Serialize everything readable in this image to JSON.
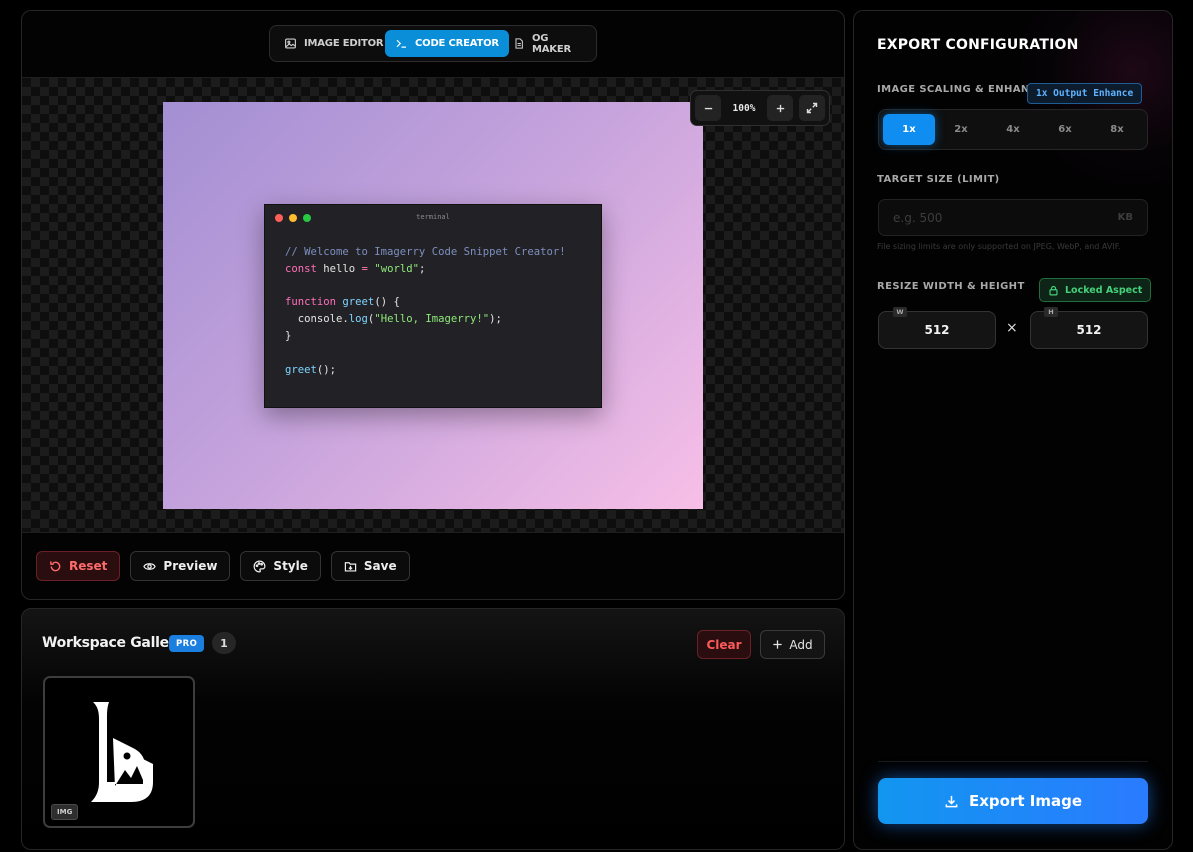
{
  "mode_tabs": [
    {
      "label": "IMAGE EDITOR",
      "icon": "image-icon",
      "active": false
    },
    {
      "label": "CODE CREATOR",
      "icon": "terminal-icon",
      "active": true
    },
    {
      "label": "OG MAKER",
      "icon": "document-icon",
      "active": false
    }
  ],
  "canvas": {
    "zoom_label": "100%",
    "terminal_title": "terminal",
    "code_lines": [
      "// Welcome to Imagerry Code Snippet Creator!",
      "const hello = \"world\";",
      "",
      "function greet() {",
      "  console.log(\"Hello, Imagerry!\");",
      "}",
      "",
      "greet();"
    ]
  },
  "actions": {
    "reset": "Reset",
    "preview": "Preview",
    "style": "Style",
    "save": "Save"
  },
  "gallery": {
    "title": "Workspace Gallery",
    "pro_badge": "PRO",
    "count": "1",
    "clear_label": "Clear",
    "add_label": "Add",
    "items": [
      {
        "tag": "IMG"
      }
    ]
  },
  "export": {
    "title": "EXPORT CONFIGURATION",
    "scaling_label": "IMAGE SCALING & ENHANCE",
    "enhance_badge": "1x Output Enhance",
    "scale_options": [
      "1x",
      "2x",
      "4x",
      "6x",
      "8x"
    ],
    "selected_scale": "1x",
    "target_label": "TARGET SIZE (LIMIT)",
    "target_placeholder": "e.g. 500",
    "target_unit": "KB",
    "target_hint": "File sizing limits are only supported on JPEG, WebP, and AVIF.",
    "resize_label": "RESIZE WIDTH & HEIGHT",
    "lock_label": "Locked Aspect",
    "width_tag": "W",
    "height_tag": "H",
    "width_value": "512",
    "height_value": "512",
    "times_symbol": "×",
    "export_button": "Export Image"
  },
  "colors": {
    "accent_blue": "#0f8df0",
    "danger_red": "#ff5a5a",
    "lock_green": "#45d07a",
    "artboard_gradient_start": "#a38fd3",
    "artboard_gradient_end": "#f7bfe7"
  }
}
